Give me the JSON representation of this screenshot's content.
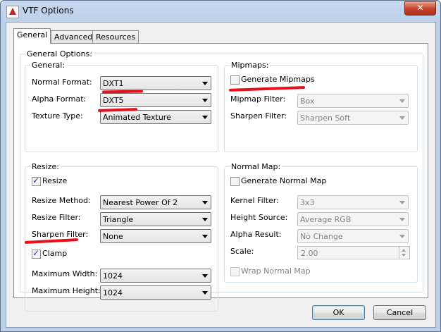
{
  "window": {
    "title": "VTF Options",
    "close_glyph": "✕"
  },
  "tabs": [
    {
      "label": "General",
      "active": true
    },
    {
      "label": "Advanced",
      "active": false
    },
    {
      "label": "Resources",
      "active": false
    }
  ],
  "general_options": {
    "label": "General Options:",
    "general": {
      "label": "General:",
      "normal_format": {
        "label": "Normal Format:",
        "value": "DXT1"
      },
      "alpha_format": {
        "label": "Alpha Format:",
        "value": "DXT5"
      },
      "texture_type": {
        "label": "Texture Type:",
        "value": "Animated Texture"
      }
    },
    "mipmaps": {
      "label": "Mipmaps:",
      "generate": {
        "label": "Generate Mipmaps",
        "checked": false
      },
      "filter": {
        "label": "Mipmap Filter:",
        "value": "Box"
      },
      "sharpen": {
        "label": "Sharpen Filter:",
        "value": "Sharpen Soft"
      }
    },
    "resize": {
      "label": "Resize:",
      "resize": {
        "label": "Resize",
        "checked": true
      },
      "method": {
        "label": "Resize Method:",
        "value": "Nearest Power Of 2"
      },
      "filter": {
        "label": "Resize Filter:",
        "value": "Triangle"
      },
      "sharpen": {
        "label": "Sharpen Filter:",
        "value": "None"
      },
      "clamp": {
        "label": "Clamp",
        "checked": true
      },
      "max_width": {
        "label": "Maximum Width:",
        "value": "1024"
      },
      "max_height": {
        "label": "Maximum Height:",
        "value": "1024"
      }
    },
    "normal_map": {
      "label": "Normal Map:",
      "generate": {
        "label": "Generate Normal Map",
        "checked": false
      },
      "kernel": {
        "label": "Kernel Filter:",
        "value": "3x3"
      },
      "height_source": {
        "label": "Height Source:",
        "value": "Average RGB"
      },
      "alpha_result": {
        "label": "Alpha Result:",
        "value": "No Change"
      },
      "scale": {
        "label": "Scale:",
        "value": "2.00"
      },
      "wrap": {
        "label": "Wrap Normal Map",
        "checked": false
      }
    }
  },
  "buttons": {
    "ok": "OK",
    "cancel": "Cancel"
  },
  "colors": {
    "annotation_red": "#e8101a",
    "title_bar": "#bcd0ea",
    "close_button": "#c7442c"
  }
}
